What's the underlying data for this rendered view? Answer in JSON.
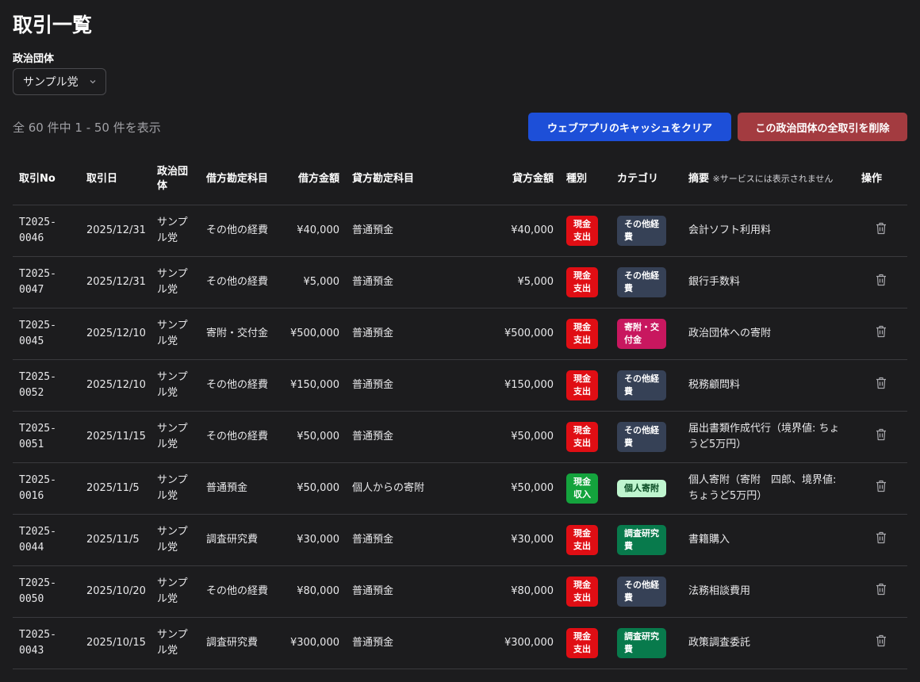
{
  "page": {
    "title": "取引一覧",
    "org_label": "政治団体",
    "org_selected": "サンプル党",
    "count_text": "全 60 件中 1 - 50 件を表示",
    "clear_cache_label": "ウェブアプリのキャッシュをクリア",
    "delete_all_label": "この政治団体の全取引を削除"
  },
  "table": {
    "headers": {
      "no": "取引No",
      "date": "取引日",
      "org": "政治団体",
      "debit_account": "借方勘定科目",
      "debit_amount": "借方金額",
      "credit_account": "貸方勘定科目",
      "credit_amount": "貸方金額",
      "type": "種別",
      "category": "カテゴリ",
      "summary": "摘要",
      "summary_note": "※サービスには表示されません",
      "actions": "操作"
    },
    "rows": [
      {
        "no": "T2025-\n0046",
        "date": "2025/12/31",
        "org": "サンプル党",
        "debit_account": "その他の経費",
        "debit_amount": "¥40,000",
        "credit_account": "普通預金",
        "credit_amount": "¥40,000",
        "type": "現金\n支出",
        "category": "その他経\n費",
        "summary": "会計ソフト利用料"
      },
      {
        "no": "T2025-\n0047",
        "date": "2025/12/31",
        "org": "サンプル党",
        "debit_account": "その他の経費",
        "debit_amount": "¥5,000",
        "credit_account": "普通預金",
        "credit_amount": "¥5,000",
        "type": "現金\n支出",
        "category": "その他経\n費",
        "summary": "銀行手数料"
      },
      {
        "no": "T2025-\n0045",
        "date": "2025/12/10",
        "org": "サンプル党",
        "debit_account": "寄附・交付金",
        "debit_amount": "¥500,000",
        "credit_account": "普通預金",
        "credit_amount": "¥500,000",
        "type": "現金\n支出",
        "category": "寄附・交\n付金",
        "summary": "政治団体への寄附"
      },
      {
        "no": "T2025-\n0052",
        "date": "2025/12/10",
        "org": "サンプル党",
        "debit_account": "その他の経費",
        "debit_amount": "¥150,000",
        "credit_account": "普通預金",
        "credit_amount": "¥150,000",
        "type": "現金\n支出",
        "category": "その他経\n費",
        "summary": "税務顧問料"
      },
      {
        "no": "T2025-\n0051",
        "date": "2025/11/15",
        "org": "サンプル党",
        "debit_account": "その他の経費",
        "debit_amount": "¥50,000",
        "credit_account": "普通預金",
        "credit_amount": "¥50,000",
        "type": "現金\n支出",
        "category": "その他経\n費",
        "summary": "届出書類作成代行（境界値: ちょうど5万円）"
      },
      {
        "no": "T2025-\n0016",
        "date": "2025/11/5",
        "org": "サンプル党",
        "debit_account": "普通預金",
        "debit_amount": "¥50,000",
        "credit_account": "個人からの寄附",
        "credit_amount": "¥50,000",
        "type": "現金\n収入",
        "category": "個人寄附",
        "summary": "個人寄附（寄附　四郎、境界値: ちょうど5万円）"
      },
      {
        "no": "T2025-\n0044",
        "date": "2025/11/5",
        "org": "サンプル党",
        "debit_account": "調査研究費",
        "debit_amount": "¥30,000",
        "credit_account": "普通預金",
        "credit_amount": "¥30,000",
        "type": "現金\n支出",
        "category": "調査研究\n費",
        "summary": "書籍購入"
      },
      {
        "no": "T2025-\n0050",
        "date": "2025/10/20",
        "org": "サンプル党",
        "debit_account": "その他の経費",
        "debit_amount": "¥80,000",
        "credit_account": "普通預金",
        "credit_amount": "¥80,000",
        "type": "現金\n支出",
        "category": "その他経\n費",
        "summary": "法務相談費用"
      },
      {
        "no": "T2025-\n0043",
        "date": "2025/10/15",
        "org": "サンプル党",
        "debit_account": "調査研究費",
        "debit_amount": "¥300,000",
        "credit_account": "普通預金",
        "credit_amount": "¥300,000",
        "type": "現金\n支出",
        "category": "調査研究\n費",
        "summary": "政策調査委託"
      }
    ]
  },
  "colors": {
    "background": "#1c1c1e",
    "primary_button": "#1d4fd8",
    "danger_button": "#a33b40",
    "expense_badge": "#e00e14",
    "income_badge": "#14a33d",
    "cat_other": "#364156",
    "cat_donation": "#c8175f",
    "cat_research": "#087a4c",
    "cat_personal": "#bff5cf"
  },
  "icons": {
    "select_chevron": "chevron-down-icon",
    "row_delete": "trash-icon"
  }
}
